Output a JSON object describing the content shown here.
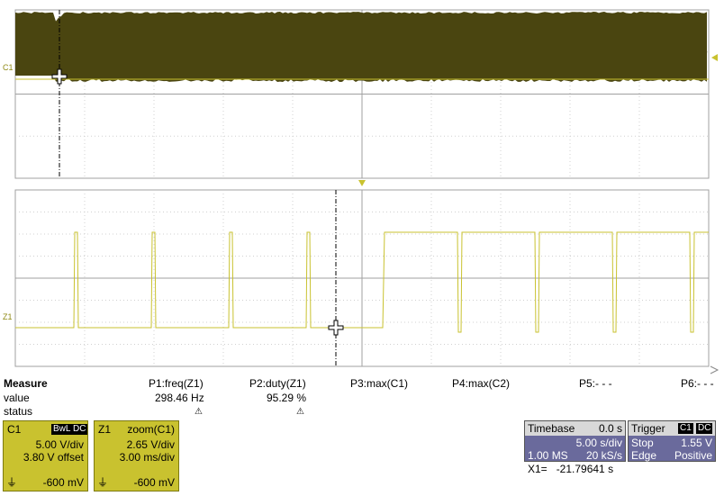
{
  "channel_marker_top": "C1",
  "channel_marker_bottom": "Z1",
  "measure": {
    "title": "Measure",
    "row_value_label": "value",
    "row_status_label": "status",
    "params": [
      {
        "name": "P1:freq(Z1)",
        "value": "298.46 Hz",
        "status": "warning-icon"
      },
      {
        "name": "P2:duty(Z1)",
        "value": "95.29 %",
        "status": "warning-icon"
      },
      {
        "name": "P3:max(C1)",
        "value": "",
        "status": ""
      },
      {
        "name": "P4:max(C2)",
        "value": "",
        "status": ""
      },
      {
        "name": "P5:- - -",
        "value": "",
        "status": ""
      },
      {
        "name": "P6:- - -",
        "value": "",
        "status": ""
      }
    ]
  },
  "c1": {
    "name": "C1",
    "tag1": "BwL",
    "tag2": "DC",
    "vdiv": "5.00 V/div",
    "offset": "3.80 V offset",
    "foot": "-600 mV"
  },
  "z1": {
    "name": "Z1",
    "source": "zoom(C1)",
    "vdiv": "2.65 V/div",
    "tdiv": "3.00 ms/div",
    "foot": "-600 mV"
  },
  "timebase": {
    "title": "Timebase",
    "delay": "0.0 s",
    "sdiv": "5.00 s/div",
    "samples": "1.00 MS",
    "rate": "20 kS/s"
  },
  "trigger": {
    "title": "Trigger",
    "tag1": "C1",
    "tag2": "DC",
    "mode": "Stop",
    "level": "1.55 V",
    "type": "Edge",
    "slope": "Positive"
  },
  "cursor": {
    "readout": "X1=   -21.79641 s"
  },
  "colors": {
    "trace": "#c9c22f",
    "envelope": "#4a4510",
    "grid": "#a0a0a0",
    "info_bg": "#6a6a9c",
    "channel_box": "#c9c22f"
  }
}
